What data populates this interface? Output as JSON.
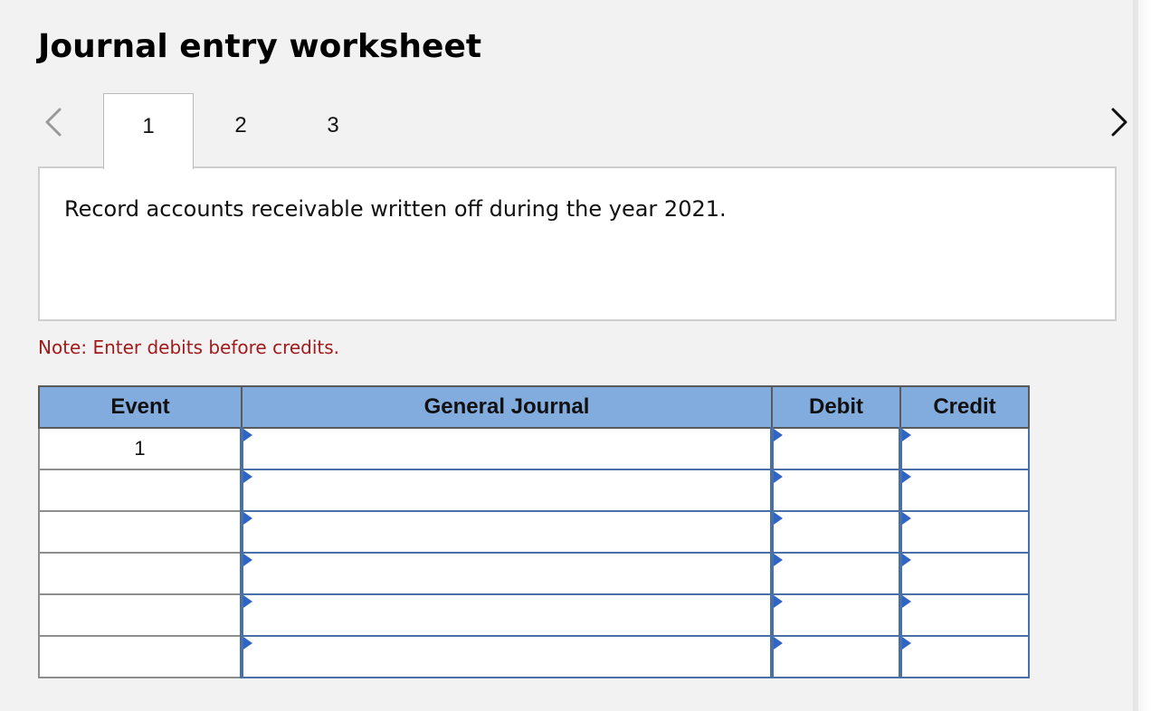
{
  "worksheet": {
    "title": "Journal entry worksheet",
    "tabs": [
      {
        "label": "1",
        "active": true
      },
      {
        "label": "2",
        "active": false
      },
      {
        "label": "3",
        "active": false
      }
    ],
    "description": "Record accounts receivable written off during the year 2021.",
    "note": "Note: Enter debits before credits."
  },
  "table": {
    "headers": {
      "event": "Event",
      "general_journal": "General Journal",
      "debit": "Debit",
      "credit": "Credit"
    },
    "rows": [
      {
        "event": "1",
        "general_journal": "",
        "debit": "",
        "credit": ""
      },
      {
        "event": "",
        "general_journal": "",
        "debit": "",
        "credit": ""
      },
      {
        "event": "",
        "general_journal": "",
        "debit": "",
        "credit": ""
      },
      {
        "event": "",
        "general_journal": "",
        "debit": "",
        "credit": ""
      },
      {
        "event": "",
        "general_journal": "",
        "debit": "",
        "credit": ""
      },
      {
        "event": "",
        "general_journal": "",
        "debit": "",
        "credit": ""
      }
    ]
  },
  "icons": {
    "prev": "chevron-left-icon",
    "next": "chevron-right-icon",
    "dropdown_marker": "dropdown-triangle-icon"
  },
  "colors": {
    "header_bg": "#82abde",
    "input_border": "#4a70a8",
    "note_text": "#a01b1b",
    "panel_bg": "#f2f2f2"
  }
}
